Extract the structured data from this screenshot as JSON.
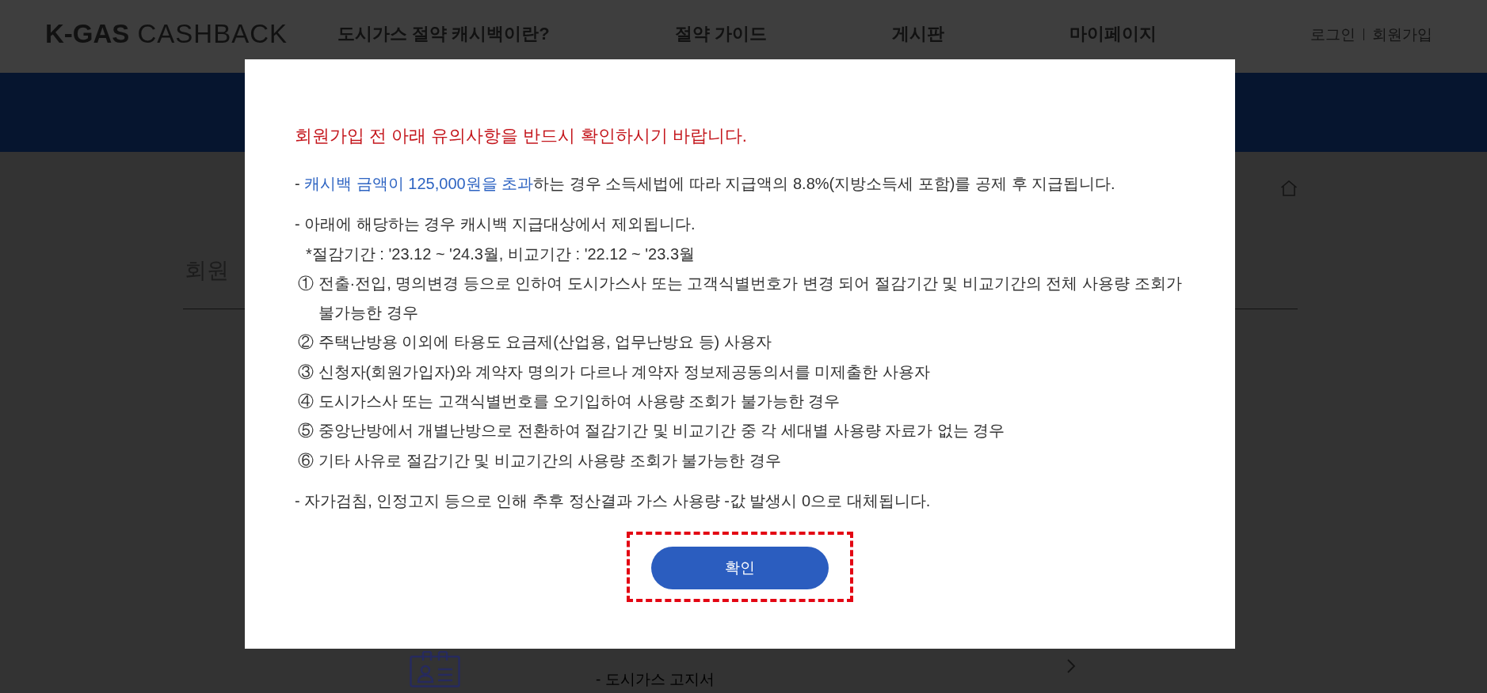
{
  "header": {
    "logo": "**K-GAS** CASHBACK",
    "nav": [
      "도시가스 절약 캐시백이란?",
      "절약 가이드",
      "게시판",
      "마이페이지"
    ],
    "auth_links": [
      "로그인",
      "회원가입"
    ]
  },
  "page": {
    "title": "회원",
    "document_item": {
      "label": "- 도시가스 고지서"
    }
  },
  "modal": {
    "title": "회원가입 전 아래 유의사항을 반드시 확인하시기 바랍니다.",
    "notices": [
      {
        "parts": [
          {
            "text": "- ",
            "emphasis": false
          },
          {
            "text": "캐시백 금액이 125,000원을 초과",
            "emphasis": true
          },
          {
            "text": "하는 경우 소득세법에 따라 지급액의 8.8%(지방소득세 포함)를 공제 후 지급됩니다.",
            "emphasis": false
          }
        ]
      },
      {
        "parts": [
          {
            "text": "- 아래에 해당하는 경우 캐시백 지급대상에서 제외됩니다.",
            "emphasis": false
          }
        ],
        "note": "*절감기간 : '23.12 ~ '24.3월, 비교기간 : '22.12 ~ '23.3월",
        "items": [
          "① 전출·전입, 명의변경 등으로 인하여 도시가스사 또는 고객식별번호가 변경 되어 절감기간 및 비교기간의 전체 사용량 조회가 불가능한 경우",
          "② 주택난방용 이외에 타용도 요금제(산업용, 업무난방요 등) 사용자",
          "③ 신청자(회원가입자)와 계약자 명의가 다르나 계약자 정보제공동의서를 미제출한 사용자",
          "④ 도시가스사 또는 고객식별번호를 오기입하여 사용량 조회가 불가능한 경우",
          "⑤ 중앙난방에서 개별난방으로 전환하여 절감기간 및 비교기간 중 각 세대별 사용량 자료가 없는 경우",
          "⑥ 기타 사유로 절감기간 및 비교기간의 사용량 조회가 불가능한 경우"
        ]
      },
      {
        "parts": [
          {
            "text": "- 자가검침, 인정고지 등으로 인해 추후 정산결과 가스 사용량 -값 발생시 0으로 대체됩니다.",
            "emphasis": false
          }
        ]
      }
    ],
    "confirm_button": {
      "label": "확인",
      "highlighted": true
    }
  }
}
